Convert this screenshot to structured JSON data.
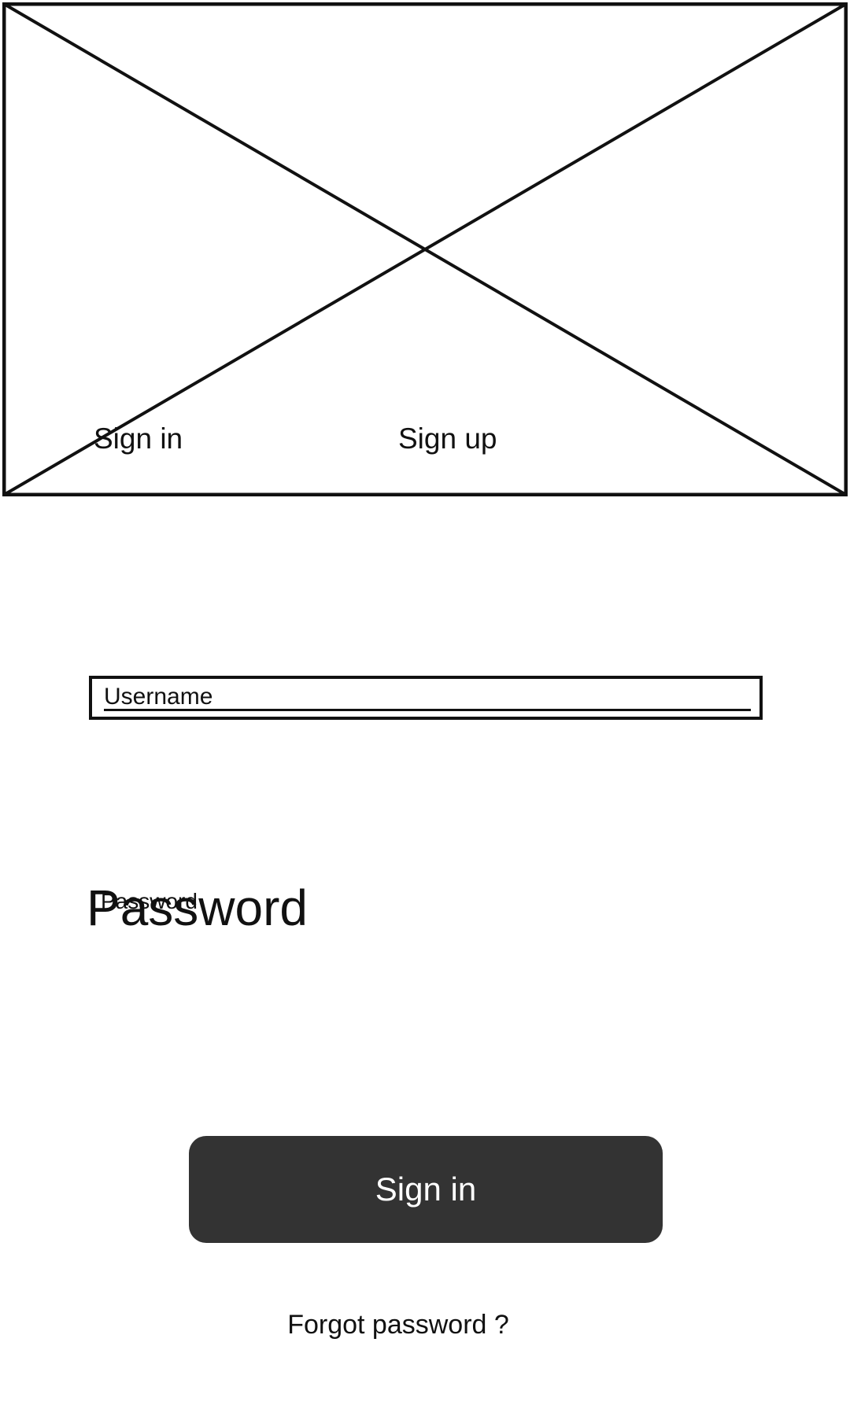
{
  "tabs": {
    "signin_label": "Sign in",
    "signup_label": "Sign up"
  },
  "form": {
    "username_placeholder": "Username",
    "password_label": "Password",
    "password_placeholder": "Password"
  },
  "actions": {
    "signin_button_label": "Sign in",
    "forgot_password_label": "Forgot password ?"
  },
  "colors": {
    "button_background": "#333333",
    "button_text": "#ffffff",
    "outline": "#111111"
  }
}
